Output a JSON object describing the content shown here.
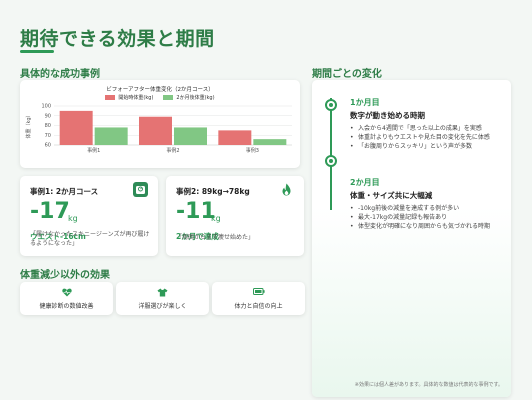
{
  "page_title": "期待できる効果と期間",
  "success_heading": "具体的な成功事例",
  "period_heading": "期間ごとの変化",
  "other_heading": "体重減少以外の効果",
  "chart_data": {
    "type": "bar",
    "title": "ビフォーアフター体重変化（2か月コース）",
    "categories": [
      "事例1",
      "事例2",
      "事例3"
    ],
    "series": [
      {
        "name": "開始時体重(kg)",
        "values": [
          95,
          89,
          75
        ]
      },
      {
        "name": "2か月後体重(kg)",
        "values": [
          78,
          78,
          66
        ]
      }
    ],
    "ylabel": "体重（kg）",
    "ylim": [
      60,
      100
    ],
    "yticks": [
      60,
      70,
      80,
      90,
      100
    ],
    "legend": "top",
    "grid": true,
    "colors": {
      "start": "#e57373",
      "after": "#81c784"
    }
  },
  "cases": [
    {
      "title": "事例1: 2か月コース",
      "value": "-17",
      "unit": "kg",
      "sub": "ウエスト-16cm",
      "quote": "「履けなかったスキニージーンズが再び履けるようになった」",
      "icon": "scale-icon"
    },
    {
      "title": "事例2: 89kg→78kg",
      "value": "-11",
      "unit": "kg",
      "sub": "2か月で達成",
      "quote": "「周囲からまず痩せ始めた」",
      "icon": "fire-icon"
    }
  ],
  "benefits": [
    {
      "label": "健康診断の数値改善",
      "icon": "heartbeat-icon"
    },
    {
      "label": "洋服選びが楽しく",
      "icon": "shirt-icon"
    },
    {
      "label": "体力と自信の向上",
      "icon": "battery-icon"
    }
  ],
  "timeline": [
    {
      "month": "1か月目",
      "heading": "数字が動き始める時期",
      "items": [
        "入会から4週間で「思った以上の成果」を実感",
        "体重計よりもウエストや見た目の変化を先に体感",
        "「お腹周りからスッキリ」という声が多数"
      ]
    },
    {
      "month": "2か月目",
      "heading": "体重・サイズ共に大幅減",
      "items": [
        "-10kg前後の減量を達成する例が多い",
        "最大-17kgの減量記録も報告あり",
        "体型変化が明確になり周囲からも気づかれる時期"
      ]
    }
  ],
  "footnote": "※効果には個人差があります。具体的な数値は代表的な事例です。",
  "accent_color": "#2e9a57"
}
